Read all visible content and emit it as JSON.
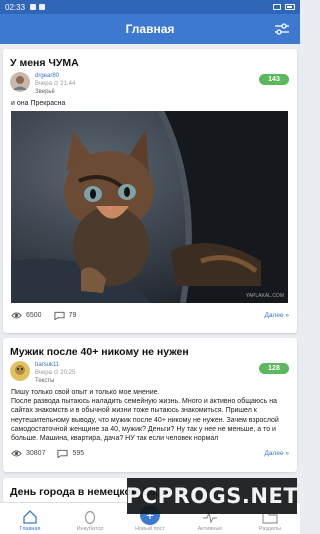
{
  "status_bar": {
    "time": "02:33"
  },
  "header": {
    "title": "Главная"
  },
  "posts": [
    {
      "title": "У меня ЧУМА",
      "author": "drgear80",
      "date": "Вчера ⊙ 21:44",
      "category": "Зверьё",
      "rating": "143",
      "subtitle": "и она Прекрасна",
      "image_watermark": "YAPLAKAL.COM",
      "views": "6500",
      "comments": "79",
      "more_label": "Далее »"
    },
    {
      "title": "Мужик после 40+ никому не нужен",
      "author": "barsuk11",
      "date": "Вчера ⊙ 20:25",
      "category": "Тексты",
      "rating": "128",
      "body": "Пишу только свой опыт и только мое мнение.\nПосле развода пытаюсь наладить семейную жизнь. Много и активно общаюсь на сайтах знакомств и в обычной жизни тоже пытаюсь знакомиться. Пришел к неутешительному выводу, что мужик после 40+ никому не нужен. Зачем взрослой самодостаточной женщине за 40, мужик? Деньги? Ну так у нее не меньше, а то и больше. Машина, квартира, дача? НУ так если человек нормал",
      "views": "30807",
      "comments": "595",
      "more_label": "Далее »"
    },
    {
      "title": "День города в немецком До..."
    }
  ],
  "bottom_nav": [
    {
      "label": "Главная",
      "icon": "home-icon",
      "active": true
    },
    {
      "label": "Инкубатор",
      "icon": "egg-icon",
      "active": false
    },
    {
      "label": "Новый пост",
      "icon": "plus-icon",
      "active": false
    },
    {
      "label": "Активные",
      "icon": "pulse-icon",
      "active": false
    },
    {
      "label": "Разделы",
      "icon": "folder-icon",
      "active": false
    }
  ],
  "overlay": {
    "watermark_text": "PCPROGS.NET"
  },
  "colors": {
    "accent": "#3c79cf",
    "status_bar": "#2f66b8",
    "rating_badge": "#5cb85c",
    "background": "#e9ecf1"
  }
}
